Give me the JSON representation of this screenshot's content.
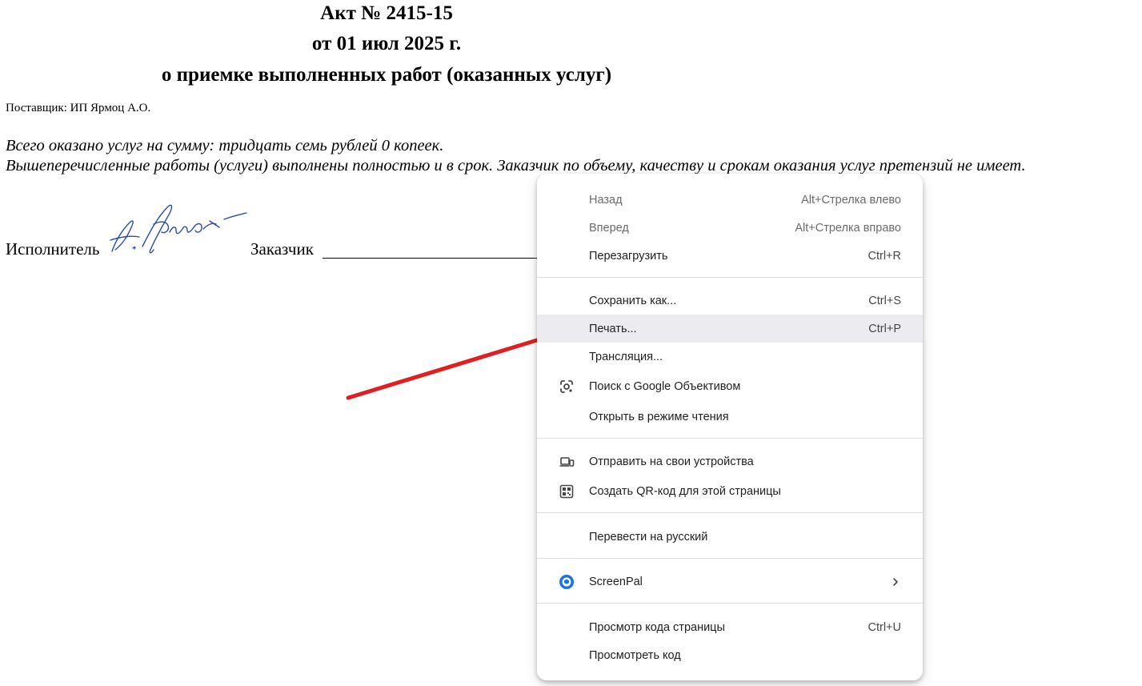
{
  "document": {
    "title_line1": "Акт № 2415-15",
    "title_line2": "от 01 июл 2025 г.",
    "title_line3": "о приемке выполненных работ (оказанных услуг)",
    "supplier": "Поставщик: ИП Ярмоц А.О.",
    "total_line": "Всего оказано услуг на сумму: тридцать семь рублей 0 копеек.",
    "statement_line": "Вышеперечисленные работы (услуги) выполнены полностью и в срок. Заказчик по объему, качеству и срокам оказания услуг претензий не имеет.",
    "executor_label": "Исполнитель",
    "customer_label": "Заказчик"
  },
  "context_menu": {
    "back": {
      "label": "Назад",
      "shortcut": "Alt+Стрелка влево"
    },
    "forward": {
      "label": "Вперед",
      "shortcut": "Alt+Стрелка вправо"
    },
    "reload": {
      "label": "Перезагрузить",
      "shortcut": "Ctrl+R"
    },
    "save_as": {
      "label": "Сохранить как...",
      "shortcut": "Ctrl+S"
    },
    "print": {
      "label": "Печать...",
      "shortcut": "Ctrl+P"
    },
    "cast": {
      "label": "Трансляция..."
    },
    "google_lens": {
      "label": "Поиск с Google Объективом",
      "icon": "google-lens-icon"
    },
    "reading_mode": {
      "label": "Открыть в режиме чтения"
    },
    "send_to_devices": {
      "label": "Отправить на свои устройства",
      "icon": "devices-icon"
    },
    "qr_code": {
      "label": "Создать QR-код для этой страницы",
      "icon": "qr-code-icon"
    },
    "translate": {
      "label": "Перевести на русский"
    },
    "screenpal": {
      "label": "ScreenPal",
      "icon": "screenpal-icon"
    },
    "view_source": {
      "label": "Просмотр кода страницы",
      "shortcut": "Ctrl+U"
    },
    "inspect": {
      "label": "Просмотреть код"
    }
  },
  "colors": {
    "arrow": "#e02020",
    "signature_ink": "#2b4bb0",
    "highlight": "#ecebf0",
    "screenpal_blue": "#1a73e8"
  }
}
